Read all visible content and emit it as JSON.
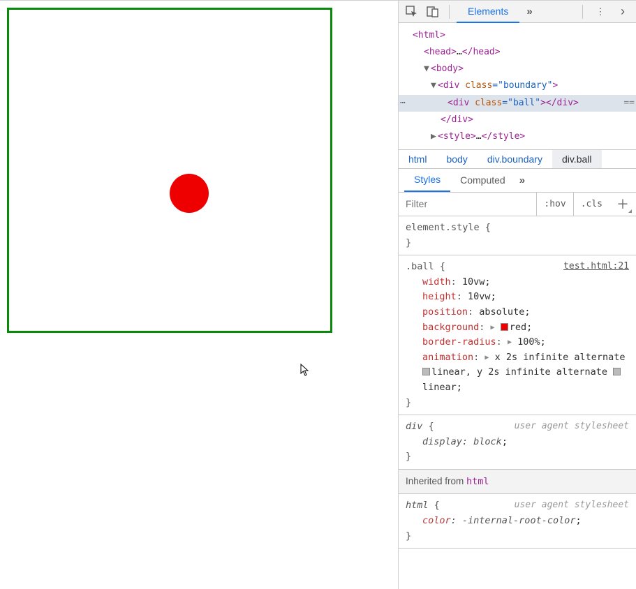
{
  "toolbar": {
    "elements_tab": "Elements"
  },
  "dom": {
    "html_open": "<html>",
    "head": "<head>…</head>",
    "body_open": "<body>",
    "div_boundary_open_tag": "div",
    "div_boundary_attr_name": "class",
    "div_boundary_attr_val": "boundary",
    "div_ball_open_tag": "div",
    "div_ball_attr_name": "class",
    "div_ball_attr_val": "ball",
    "div_close": "</div>",
    "style_open": "<style>",
    "style_ellipsis": "…",
    "style_close": "</style>"
  },
  "breadcrumb": {
    "c0": "html",
    "c1": "body",
    "c2": "div.boundary",
    "c3": "div.ball"
  },
  "subtabs": {
    "styles": "Styles",
    "computed": "Computed"
  },
  "filter": {
    "placeholder": "Filter",
    "hov": ":hov",
    "cls": ".cls"
  },
  "styles": {
    "element_style_sel": "element.style",
    "ball_sel": ".ball",
    "ball_src": "test.html:21",
    "ball_decls": {
      "width": {
        "p": "width",
        "v": "10vw"
      },
      "height": {
        "p": "height",
        "v": "10vw"
      },
      "position": {
        "p": "position",
        "v": "absolute"
      },
      "background": {
        "p": "background",
        "v": "red"
      },
      "border_radius": {
        "p": "border-radius",
        "v": "100%"
      },
      "animation_p": "animation",
      "animation_v1": "x 2s infinite alternate ",
      "animation_v2": "linear, y 2s infinite alternate ",
      "animation_v3": "linear"
    },
    "div_sel": "div",
    "ua_note": "user agent stylesheet",
    "div_display": {
      "p": "display",
      "v": "block"
    },
    "inherited_label": "Inherited from ",
    "inherited_from": "html",
    "html_sel": "html",
    "html_color": {
      "p": "color",
      "v": "-internal-root-color"
    }
  },
  "glyph": {
    "open_brace": " {",
    "close_brace": "}",
    "semi": ";",
    "colon": ": ",
    "chevrons": "»",
    "tri_right": "▶",
    "tri_down": "▼",
    "kebab": "⋮"
  }
}
